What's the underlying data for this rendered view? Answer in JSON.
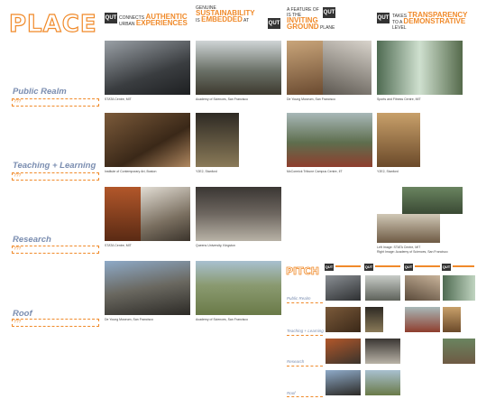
{
  "title": "PLACE",
  "rows": [
    "Public Realm",
    "Teaching + Learning",
    "Research",
    "Roof"
  ],
  "placeholder": "???",
  "qut_logo": "QUT",
  "columns": [
    {
      "pre": "CONNECTS",
      "accent": "AUTHENTIC",
      "mid": "URBAN",
      "accent2": "EXPERIENCES"
    },
    {
      "pre": "GENUINE",
      "accent": "SUSTAINABILITY",
      "mid": "IS",
      "accent2": "EMBEDDED",
      "post": "AT"
    },
    {
      "pre": "A FEATURE OF",
      "mid": "IS THE",
      "accent": "INVITING",
      "accent2": "GROUND",
      "post": "PLANE"
    },
    {
      "pre": "TAKES",
      "accent": "TRANSPARENCY",
      "mid": "TO A",
      "accent2": "DEMONSTRATIVE",
      "post": "LEVEL"
    }
  ],
  "captions": {
    "r1c1": "STATA Centre, MIT",
    "r1c2": "Academy of Sciences, San Francisco",
    "r1c3": "De Young Museum, San Francisco",
    "r1c4": "Sports and Fitness Centre, MIT",
    "r2c1": "Institute of Contemporary Art, Boston",
    "r2c2": "Y2E2, Stanford",
    "r2c3": "McCormick Tribune Campus Centre, IIT",
    "r2c4": "Y2E2, Stanford",
    "r3c1": "STATA Centre, MIT",
    "r3c2": "Queens University, Kingston",
    "r3c4a": "Left Image: STATA Centre, MIT",
    "r3c4b": "Right Image: Academy of Sciences, San Francisco",
    "r4c1": "De Young Museum, San Francisco",
    "r4c2": "Academy of Sciences, San Francisco"
  },
  "pitch": {
    "title": "PITCH",
    "rows": [
      "Public Realm",
      "Teaching + Learning",
      "Research",
      "Roof"
    ]
  }
}
